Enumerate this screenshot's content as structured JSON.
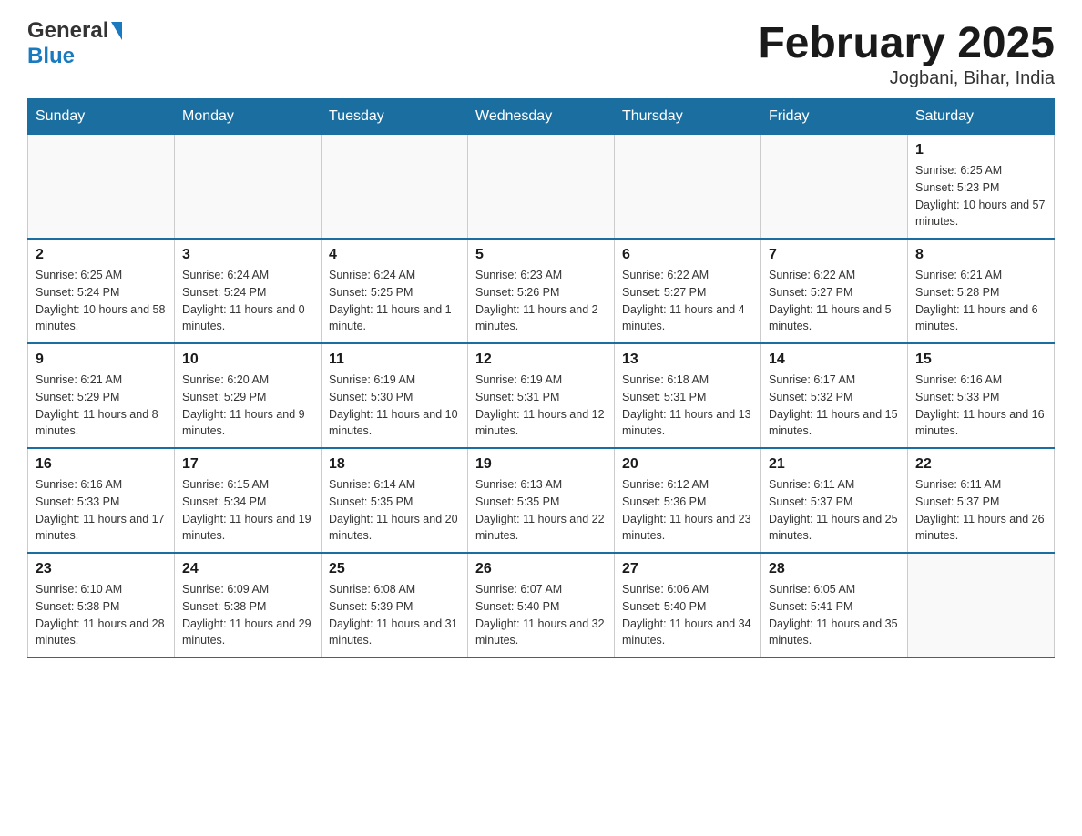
{
  "header": {
    "logo_general": "General",
    "logo_blue": "Blue",
    "title": "February 2025",
    "subtitle": "Jogbani, Bihar, India"
  },
  "calendar": {
    "days_of_week": [
      "Sunday",
      "Monday",
      "Tuesday",
      "Wednesday",
      "Thursday",
      "Friday",
      "Saturday"
    ],
    "weeks": [
      [
        {
          "day": "",
          "info": ""
        },
        {
          "day": "",
          "info": ""
        },
        {
          "day": "",
          "info": ""
        },
        {
          "day": "",
          "info": ""
        },
        {
          "day": "",
          "info": ""
        },
        {
          "day": "",
          "info": ""
        },
        {
          "day": "1",
          "info": "Sunrise: 6:25 AM\nSunset: 5:23 PM\nDaylight: 10 hours and 57 minutes."
        }
      ],
      [
        {
          "day": "2",
          "info": "Sunrise: 6:25 AM\nSunset: 5:24 PM\nDaylight: 10 hours and 58 minutes."
        },
        {
          "day": "3",
          "info": "Sunrise: 6:24 AM\nSunset: 5:24 PM\nDaylight: 11 hours and 0 minutes."
        },
        {
          "day": "4",
          "info": "Sunrise: 6:24 AM\nSunset: 5:25 PM\nDaylight: 11 hours and 1 minute."
        },
        {
          "day": "5",
          "info": "Sunrise: 6:23 AM\nSunset: 5:26 PM\nDaylight: 11 hours and 2 minutes."
        },
        {
          "day": "6",
          "info": "Sunrise: 6:22 AM\nSunset: 5:27 PM\nDaylight: 11 hours and 4 minutes."
        },
        {
          "day": "7",
          "info": "Sunrise: 6:22 AM\nSunset: 5:27 PM\nDaylight: 11 hours and 5 minutes."
        },
        {
          "day": "8",
          "info": "Sunrise: 6:21 AM\nSunset: 5:28 PM\nDaylight: 11 hours and 6 minutes."
        }
      ],
      [
        {
          "day": "9",
          "info": "Sunrise: 6:21 AM\nSunset: 5:29 PM\nDaylight: 11 hours and 8 minutes."
        },
        {
          "day": "10",
          "info": "Sunrise: 6:20 AM\nSunset: 5:29 PM\nDaylight: 11 hours and 9 minutes."
        },
        {
          "day": "11",
          "info": "Sunrise: 6:19 AM\nSunset: 5:30 PM\nDaylight: 11 hours and 10 minutes."
        },
        {
          "day": "12",
          "info": "Sunrise: 6:19 AM\nSunset: 5:31 PM\nDaylight: 11 hours and 12 minutes."
        },
        {
          "day": "13",
          "info": "Sunrise: 6:18 AM\nSunset: 5:31 PM\nDaylight: 11 hours and 13 minutes."
        },
        {
          "day": "14",
          "info": "Sunrise: 6:17 AM\nSunset: 5:32 PM\nDaylight: 11 hours and 15 minutes."
        },
        {
          "day": "15",
          "info": "Sunrise: 6:16 AM\nSunset: 5:33 PM\nDaylight: 11 hours and 16 minutes."
        }
      ],
      [
        {
          "day": "16",
          "info": "Sunrise: 6:16 AM\nSunset: 5:33 PM\nDaylight: 11 hours and 17 minutes."
        },
        {
          "day": "17",
          "info": "Sunrise: 6:15 AM\nSunset: 5:34 PM\nDaylight: 11 hours and 19 minutes."
        },
        {
          "day": "18",
          "info": "Sunrise: 6:14 AM\nSunset: 5:35 PM\nDaylight: 11 hours and 20 minutes."
        },
        {
          "day": "19",
          "info": "Sunrise: 6:13 AM\nSunset: 5:35 PM\nDaylight: 11 hours and 22 minutes."
        },
        {
          "day": "20",
          "info": "Sunrise: 6:12 AM\nSunset: 5:36 PM\nDaylight: 11 hours and 23 minutes."
        },
        {
          "day": "21",
          "info": "Sunrise: 6:11 AM\nSunset: 5:37 PM\nDaylight: 11 hours and 25 minutes."
        },
        {
          "day": "22",
          "info": "Sunrise: 6:11 AM\nSunset: 5:37 PM\nDaylight: 11 hours and 26 minutes."
        }
      ],
      [
        {
          "day": "23",
          "info": "Sunrise: 6:10 AM\nSunset: 5:38 PM\nDaylight: 11 hours and 28 minutes."
        },
        {
          "day": "24",
          "info": "Sunrise: 6:09 AM\nSunset: 5:38 PM\nDaylight: 11 hours and 29 minutes."
        },
        {
          "day": "25",
          "info": "Sunrise: 6:08 AM\nSunset: 5:39 PM\nDaylight: 11 hours and 31 minutes."
        },
        {
          "day": "26",
          "info": "Sunrise: 6:07 AM\nSunset: 5:40 PM\nDaylight: 11 hours and 32 minutes."
        },
        {
          "day": "27",
          "info": "Sunrise: 6:06 AM\nSunset: 5:40 PM\nDaylight: 11 hours and 34 minutes."
        },
        {
          "day": "28",
          "info": "Sunrise: 6:05 AM\nSunset: 5:41 PM\nDaylight: 11 hours and 35 minutes."
        },
        {
          "day": "",
          "info": ""
        }
      ]
    ]
  }
}
